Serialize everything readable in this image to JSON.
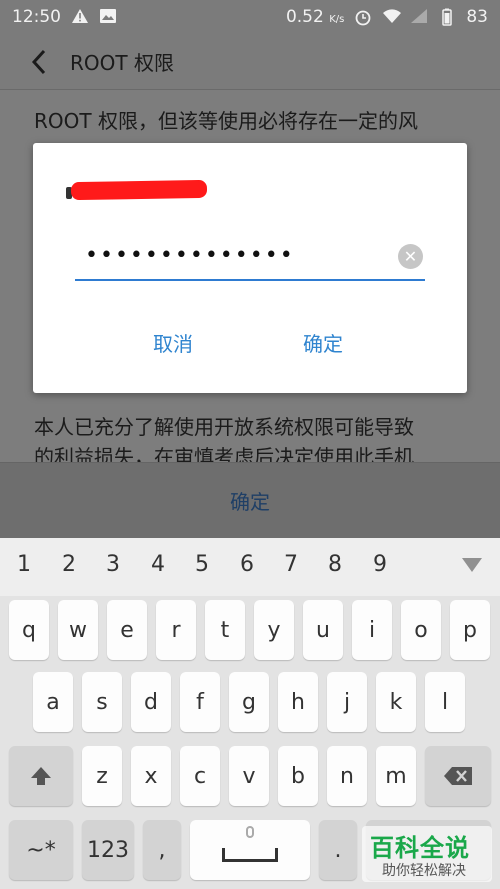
{
  "status_bar": {
    "time": "12:50",
    "speed": "0.52",
    "speed_unit": "K/s",
    "battery": "83"
  },
  "app_bar": {
    "title": "ROOT 权限"
  },
  "page": {
    "line1": "ROOT 权限，但该等使用必将存在一定的风",
    "line2": "本人已充分了解使用开放系统权限可能导致",
    "line3": "的利益损失，在审慎考虑后决定使用此手机",
    "confirm_label": "确定"
  },
  "dialog": {
    "password_masked": "••••••••••••••",
    "cancel_label": "取消",
    "ok_label": "确定"
  },
  "keyboard": {
    "numbers": [
      "1",
      "2",
      "3",
      "4",
      "5",
      "6",
      "7",
      "8",
      "9"
    ],
    "row1": [
      "q",
      "w",
      "e",
      "r",
      "t",
      "y",
      "u",
      "i",
      "o",
      "p"
    ],
    "row2": [
      "a",
      "s",
      "d",
      "f",
      "g",
      "h",
      "j",
      "k",
      "l"
    ],
    "row3": [
      "z",
      "x",
      "c",
      "v",
      "b",
      "n",
      "m"
    ],
    "symbols_label": "~*",
    "numbers_label": "123",
    "comma_label": ",",
    "period_label": "."
  },
  "watermark": {
    "title": "百科全说",
    "subtitle": "助你轻松解决"
  }
}
